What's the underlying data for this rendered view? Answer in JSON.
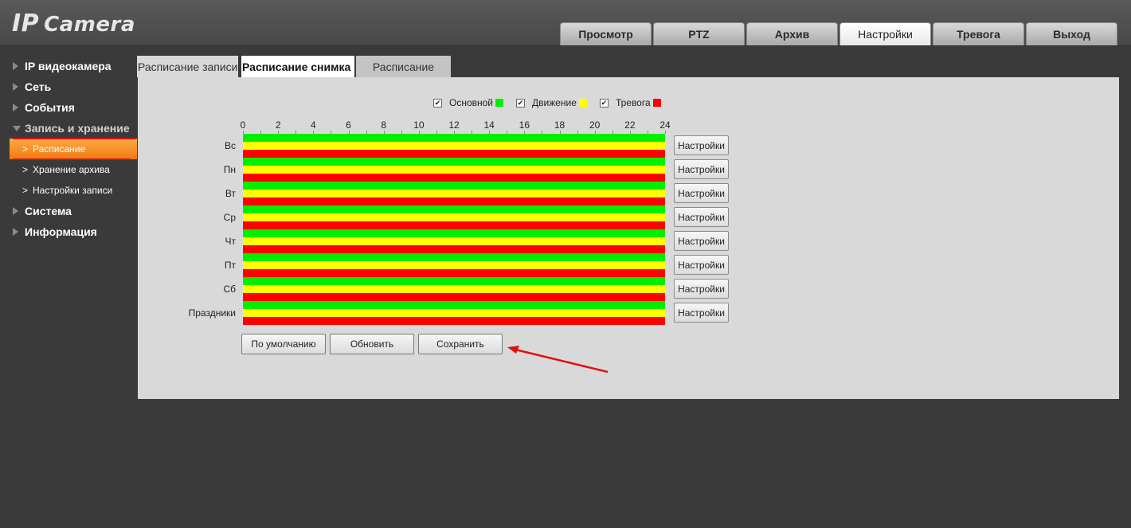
{
  "logo": {
    "big": "IP",
    "small": "Camera"
  },
  "topnav": [
    "Просмотр",
    "PTZ",
    "Архив",
    "Настройки",
    "Тревога",
    "Выход"
  ],
  "topnav_active": 3,
  "sidebar": {
    "items": [
      {
        "label": "IP видеокамера"
      },
      {
        "label": "Сеть"
      },
      {
        "label": "События"
      },
      {
        "label": "Запись и хранение"
      },
      {
        "label": "Система"
      },
      {
        "label": "Информация"
      }
    ],
    "sub": [
      {
        "label": "Расписание"
      },
      {
        "label": "Хранение архива"
      },
      {
        "label": "Настройки записи"
      }
    ],
    "chevron": ">"
  },
  "tabs": [
    "Расписание записи",
    "Расписание снимка",
    "Расписание"
  ],
  "legend": [
    {
      "label": "Основной",
      "color": "#00ee00",
      "checked": "✔"
    },
    {
      "label": "Движение",
      "color": "#ffff00",
      "checked": "✔"
    },
    {
      "label": "Тревога",
      "color": "#ff0000",
      "checked": "✔"
    }
  ],
  "hours": [
    "0",
    "2",
    "4",
    "6",
    "8",
    "10",
    "12",
    "14",
    "16",
    "18",
    "20",
    "22",
    "24"
  ],
  "days": [
    "Вс",
    "Пн",
    "Вт",
    "Ср",
    "Чт",
    "Пт",
    "Сб",
    "Праздники"
  ],
  "bar_colors": [
    "#00ee00",
    "#ffff00",
    "#ff0000"
  ],
  "settings_label": "Настройки",
  "buttons": {
    "default": "По умолчанию",
    "refresh": "Обновить",
    "save": "Сохранить"
  },
  "accent": "#e01010"
}
